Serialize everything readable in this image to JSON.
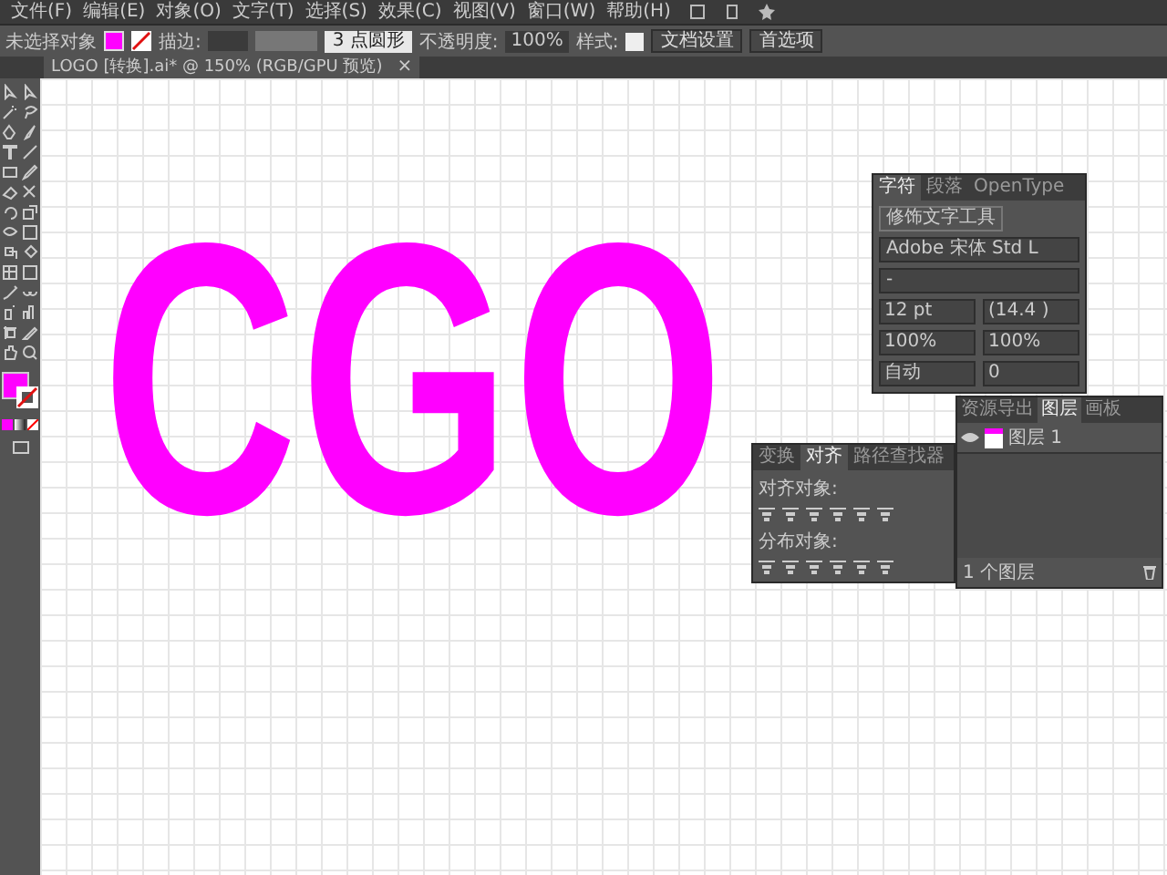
{
  "menu_bar": {
    "items": [
      "文件(F)",
      "编辑(E)",
      "对象(O)",
      "文字(T)",
      "选择(S)",
      "效果(C)",
      "视图(V)",
      "窗口(W)",
      "帮助(H)"
    ]
  },
  "control_bar": {
    "selection": "未选择对象",
    "stroke_label": "描边:",
    "stroke_weight": "3 点圆形",
    "opacity_label": "不透明度:",
    "opacity": "100%",
    "style_label": "样式:",
    "buttons": [
      "文档设置",
      "首选项"
    ]
  },
  "document_tab": {
    "title": "LOGO [转换].ai* @ 150% (RGB/GPU 预览)",
    "close": "×"
  },
  "canvas": {
    "artwork_text": "CGO"
  },
  "character_panel": {
    "tabs": [
      {
        "label": "字符",
        "selected": true
      },
      {
        "label": "段落",
        "selected": false
      },
      {
        "label": "OpenType",
        "selected": false
      }
    ],
    "touch_tool": "修饰文字工具",
    "font_family": "Adobe 宋体 Std L",
    "font_style": "-",
    "font_size": "12 pt",
    "leading": "(14.4 )",
    "vertical_scale": "100%",
    "horizontal_scale": "100%",
    "kerning": "自动",
    "tracking": "0"
  },
  "align_panel": {
    "tabs": [
      {
        "label": "变换",
        "selected": false
      },
      {
        "label": "对齐",
        "selected": true
      },
      {
        "label": "路径查找器",
        "selected": false
      }
    ],
    "sections": [
      "对齐对象:",
      "分布对象:"
    ]
  },
  "layers_panel": {
    "tabs": [
      {
        "label": "资源导出",
        "selected": false
      },
      {
        "label": "图层",
        "selected": true
      },
      {
        "label": "画板",
        "selected": false
      }
    ],
    "layers": [
      {
        "name": "图层 1",
        "visible": true
      }
    ],
    "footer": "1 个图层"
  }
}
